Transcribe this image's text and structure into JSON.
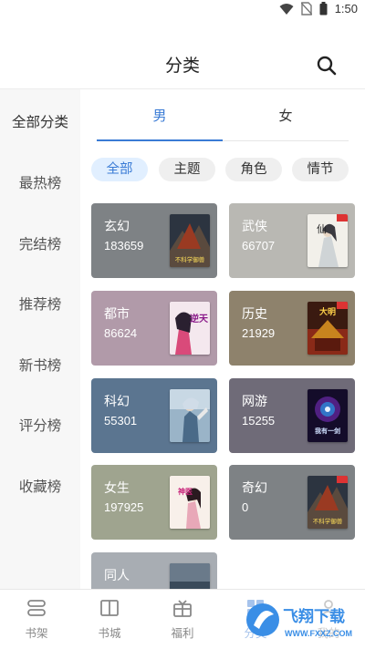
{
  "status_bar": {
    "time": "1:50"
  },
  "header": {
    "title": "分类"
  },
  "sidebar": {
    "items": [
      {
        "label": "全部分类"
      },
      {
        "label": "最热榜"
      },
      {
        "label": "完结榜"
      },
      {
        "label": "推荐榜"
      },
      {
        "label": "新书榜"
      },
      {
        "label": "评分榜"
      },
      {
        "label": "收藏榜"
      }
    ]
  },
  "gender_tabs": [
    {
      "label": "男"
    },
    {
      "label": "女"
    }
  ],
  "chips": [
    {
      "label": "全部"
    },
    {
      "label": "主题"
    },
    {
      "label": "角色"
    },
    {
      "label": "情节"
    }
  ],
  "categories": [
    {
      "name": "玄幻",
      "count": "183659",
      "color": "#7e8285"
    },
    {
      "name": "武侠",
      "count": "66707",
      "color": "#b9b8b3"
    },
    {
      "name": "都市",
      "count": "86624",
      "color": "#b19aa9"
    },
    {
      "name": "历史",
      "count": "21929",
      "color": "#8e826c"
    },
    {
      "name": "科幻",
      "count": "55301",
      "color": "#5b7590"
    },
    {
      "name": "网游",
      "count": "15255",
      "color": "#6f6b78"
    },
    {
      "name": "女生",
      "count": "197925",
      "color": "#9fa48f"
    },
    {
      "name": "奇幻",
      "count": "0",
      "color": "#7e8285"
    },
    {
      "name": "同人",
      "count": "",
      "color": "#a8adb3"
    }
  ],
  "covers": [
    {
      "text": "不科学御兽"
    },
    {
      "text": "仙"
    },
    {
      "text": "逆天"
    },
    {
      "text": "大明"
    },
    {
      "text": ""
    },
    {
      "text": "我有一剑"
    },
    {
      "text": "神医"
    },
    {
      "text": "不科学御兽"
    }
  ],
  "bottom_nav": [
    {
      "label": "书架"
    },
    {
      "label": "书城"
    },
    {
      "label": "福利"
    },
    {
      "label": "分类"
    },
    {
      "label": "我的"
    }
  ],
  "watermark": {
    "brand": "飞翔下载",
    "url": "WWW.FXXZ.COM"
  },
  "colors": {
    "accent": "#3a7bd5",
    "sidebar_bg": "#f7f7f7"
  }
}
